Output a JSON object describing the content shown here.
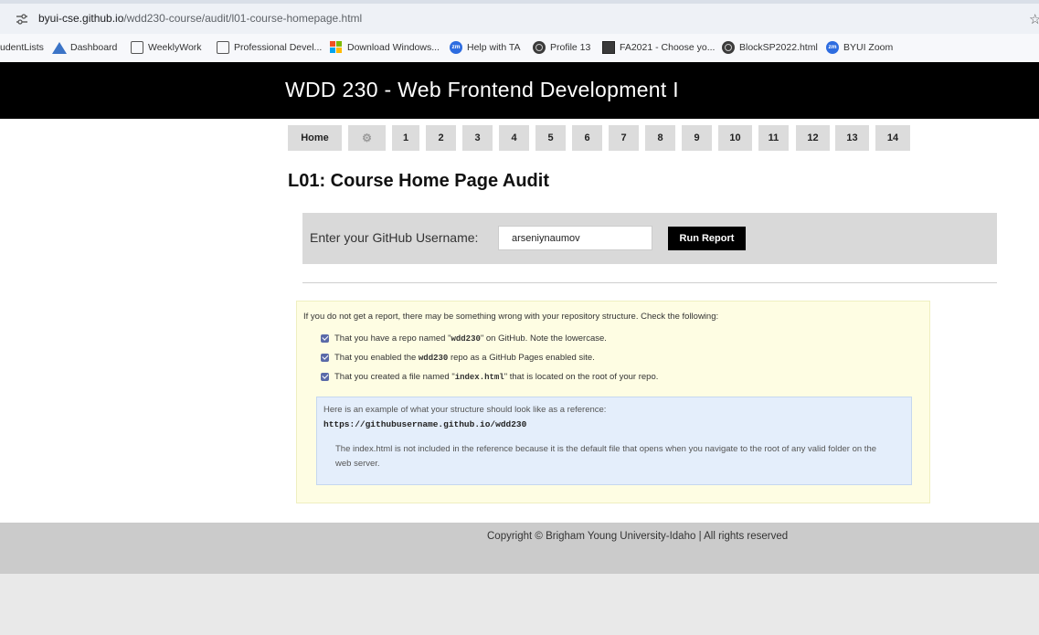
{
  "browser": {
    "url_host": "byui-cse.github.io",
    "url_path": "/wdd230-course/audit/l01-course-homepage.html",
    "bookmarks": [
      {
        "label": "udentLists",
        "icon": "none"
      },
      {
        "label": "Dashboard",
        "icon": "canvas-icon"
      },
      {
        "label": "WeeklyWork",
        "icon": "folder-icon"
      },
      {
        "label": "Professional Devel...",
        "icon": "folder-icon"
      },
      {
        "label": "Download Windows...",
        "icon": "windows-icon"
      },
      {
        "label": "Help with TA",
        "icon": "zoom-icon"
      },
      {
        "label": "Profile 13",
        "icon": "globe-icon"
      },
      {
        "label": "FA2021 - Choose yo...",
        "icon": "fa-icon"
      },
      {
        "label": "BlockSP2022.html",
        "icon": "globe-icon"
      },
      {
        "label": "BYUI Zoom",
        "icon": "zoom-icon"
      }
    ]
  },
  "header": {
    "title": "WDD 230 - Web Frontend Development I"
  },
  "nav": {
    "home_label": "Home",
    "settings_icon": "gear-icon",
    "weeks": [
      "1",
      "2",
      "3",
      "4",
      "5",
      "6",
      "7",
      "8",
      "9",
      "10",
      "11",
      "12",
      "13",
      "14"
    ]
  },
  "page": {
    "heading": "L01: Course Home Page Audit"
  },
  "form": {
    "label": "Enter your GitHub Username:",
    "username_value": "arseniynaumov",
    "run_label": "Run Report"
  },
  "info": {
    "intro": "If you do not get a report, there may be something wrong with your repository structure. Check the following:",
    "checks": [
      {
        "pre": "That you have a repo named \"",
        "code": "wdd230",
        "post": "\" on GitHub. Note the lowercase."
      },
      {
        "pre": "That you enabled the ",
        "code": "wdd230",
        "post": " repo as a GitHub Pages enabled site."
      },
      {
        "pre": "That you created a file named \"",
        "code": "index.html",
        "post": "\" that is located on the root of your repo."
      }
    ],
    "example_intro": "Here is an example of what your structure should look like as a reference:",
    "example_url": "https://githubusername.github.io/wdd230",
    "example_note": "The index.html is not included in the reference because it is the default file that opens when you navigate to the root of any valid folder on the web server."
  },
  "footer": {
    "text": "Copyright © Brigham Young University-Idaho | All rights reserved"
  }
}
